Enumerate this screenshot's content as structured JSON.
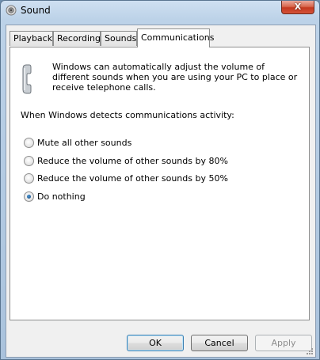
{
  "window": {
    "title": "Sound",
    "close_glyph": "X"
  },
  "tabs": [
    {
      "label": "Playback",
      "active": false
    },
    {
      "label": "Recording",
      "active": false
    },
    {
      "label": "Sounds",
      "active": false
    },
    {
      "label": "Communications",
      "active": true
    }
  ],
  "communications": {
    "description": "Windows can automatically adjust the volume of different sounds when you are using your PC to place or receive telephone calls.",
    "group_label": "When Windows detects communications activity:",
    "options": [
      {
        "label": "Mute all other sounds",
        "selected": false
      },
      {
        "label": "Reduce the volume of other sounds by 80%",
        "selected": false
      },
      {
        "label": "Reduce the volume of other sounds by 50%",
        "selected": false
      },
      {
        "label": "Do nothing",
        "selected": true
      }
    ]
  },
  "buttons": {
    "ok": "OK",
    "cancel": "Cancel",
    "apply": "Apply"
  },
  "colors": {
    "accent": "#3c7fb1",
    "window_frame": "#bcd2e8",
    "close": "#c4391f"
  },
  "icons": {
    "title": "speaker-icon",
    "panel": "telephone-handset-icon"
  }
}
